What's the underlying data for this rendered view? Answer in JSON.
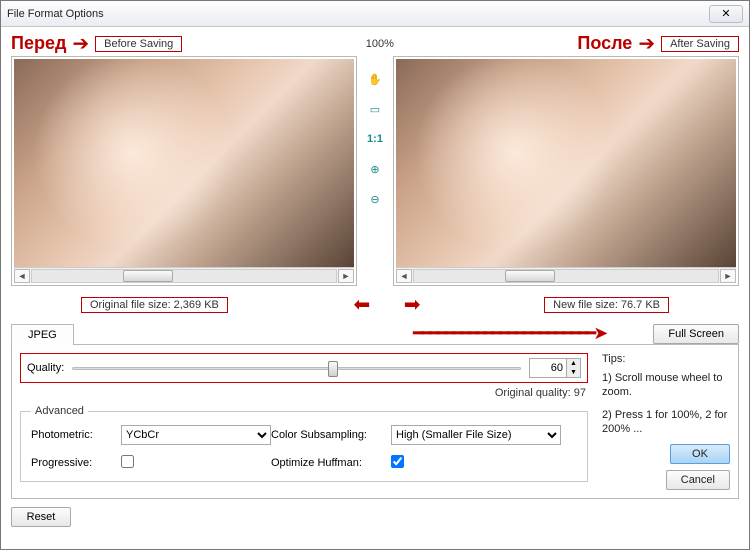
{
  "window": {
    "title": "File Format Options"
  },
  "annot": {
    "before_ru": "Перед",
    "before_en": "Before Saving",
    "after_ru": "После",
    "after_en": "After Saving",
    "zoom_pct": "100%"
  },
  "sizes": {
    "original_label": "Original file size:",
    "original_value": "2,369 KB",
    "new_label": "New file size:",
    "new_value": "76.7 KB"
  },
  "tabs": {
    "jpeg": "JPEG"
  },
  "buttons": {
    "full_screen": "Full Screen",
    "ok": "OK",
    "cancel": "Cancel",
    "reset": "Reset"
  },
  "quality": {
    "label": "Quality:",
    "value": "60",
    "orig_label": "Original quality:",
    "orig_value": "97"
  },
  "advanced": {
    "legend": "Advanced",
    "photometric_label": "Photometric:",
    "photometric_value": "YCbCr",
    "progressive_label": "Progressive:",
    "subsampling_label": "Color Subsampling:",
    "subsampling_value": "High (Smaller File Size)",
    "huffman_label": "Optimize Huffman:"
  },
  "tips": {
    "header": "Tips:",
    "t1": "1) Scroll mouse wheel to zoom.",
    "t2": "2) Press 1 for 100%, 2 for 200% ..."
  },
  "tools": {
    "hand": "✋",
    "fit": "▭",
    "actual": "1:1",
    "zoom_in": "⊕",
    "zoom_out": "⊖"
  }
}
